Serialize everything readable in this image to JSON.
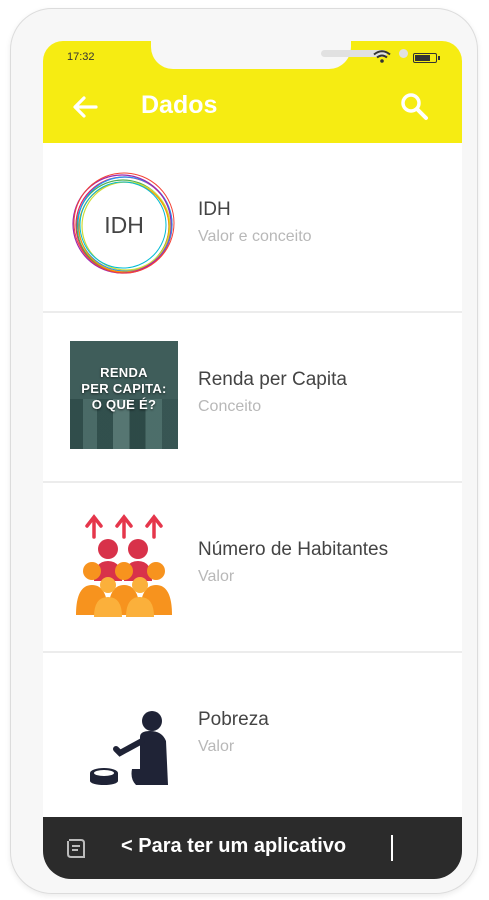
{
  "status": {
    "time": "17:32"
  },
  "appbar": {
    "title": "Dados",
    "back_icon": "arrow-left-icon",
    "search_icon": "search-icon"
  },
  "items": [
    {
      "title": "IDH",
      "subtitle": "Valor e conceito",
      "thumb": "IDH"
    },
    {
      "title": "Renda per Capita",
      "subtitle": "Conceito",
      "thumb_lines": [
        "RENDA",
        "PER CAPITA:",
        "O QUE É?"
      ]
    },
    {
      "title": "Número de Habitantes",
      "subtitle": "Valor",
      "thumb": "people-growth-icon"
    },
    {
      "title": "Pobreza",
      "subtitle": "Valor",
      "thumb": "poverty-icon"
    }
  ],
  "bottombar": {
    "text": "< Para ter um aplicativo",
    "icon": "notes-icon"
  },
  "colors": {
    "accent": "#f6ec12",
    "bottombar": "#2b2b2b",
    "subtitle": "#b8b8b8"
  }
}
